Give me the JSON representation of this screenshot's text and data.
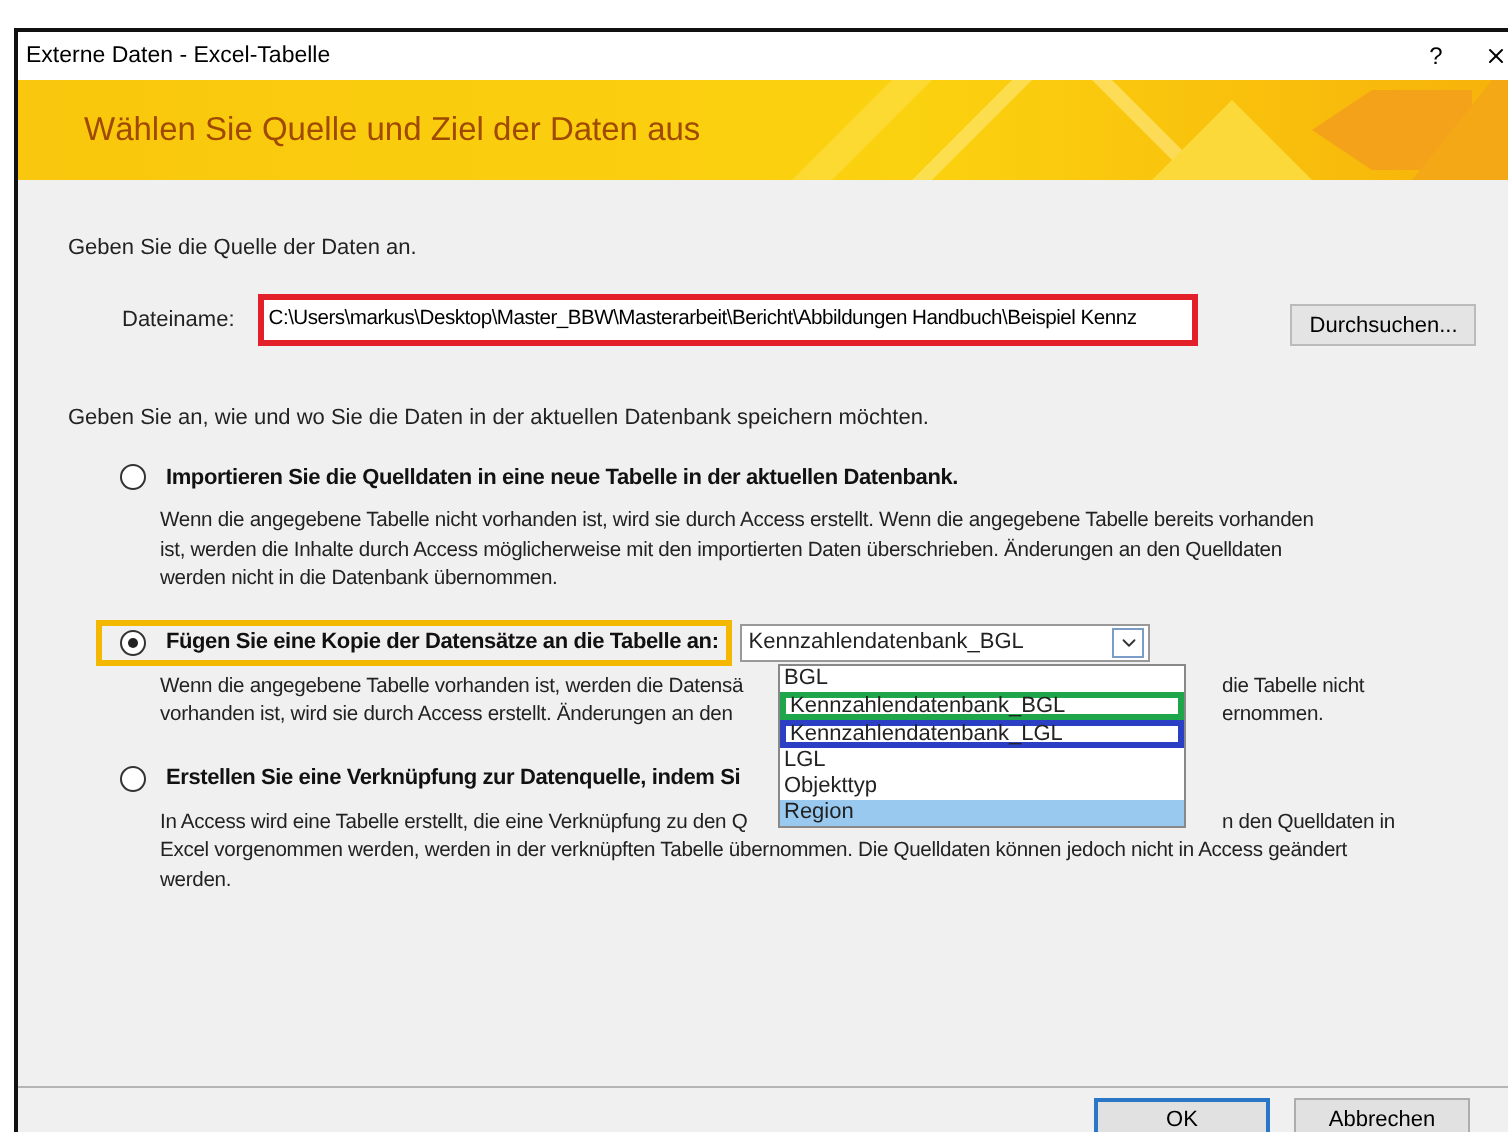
{
  "window": {
    "title": "Externe Daten - Excel-Tabelle",
    "help": "?"
  },
  "banner": {
    "title": "Wählen Sie Quelle und Ziel der Daten aus"
  },
  "source": {
    "prompt": "Geben Sie die Quelle der Daten an.",
    "label": "Dateiname:",
    "value": "C:\\Users\\markus\\Desktop\\Master_BBW\\Masterarbeit\\Bericht\\Abbildungen Handbuch\\Beispiel Kennz",
    "color": "#e3202a",
    "browse": "Durchsuchen..."
  },
  "target_prompt": "Geben Sie an, wie und wo Sie die Daten in der aktuellen Datenbank speichern möchten.",
  "options": [
    {
      "title": "Importieren Sie die Quelldaten in eine neue Tabelle in der aktuellen Datenbank.",
      "selected": false,
      "lines": [
        [
          "Wenn die angegebene Tabelle nicht vorhanden ist, wird sie durch Access erstellt. Wenn die angegebene Tabelle bereits vorhanden"
        ],
        [
          "ist, werden die Inhalte durch Access möglicherweise mit den importierten Daten überschrieben. Änderungen an den Quelldaten"
        ],
        [
          "werden nicht in die Datenbank übernommen."
        ]
      ]
    },
    {
      "title": "Fügen Sie eine Kopie der Datensätze an die Tabelle an:",
      "selected": true,
      "color": "#f5b800",
      "combo": "Kennzahlendatenbank_BGL",
      "lines": [
        [
          "Wenn die angegebene Tabelle vorhanden ist, werden die Datensä",
          "die Tabelle nicht"
        ],
        [
          "vorhanden ist, wird sie durch Access erstellt. Änderungen an den",
          "ernommen."
        ]
      ]
    },
    {
      "title": "Erstellen Sie eine Verknüpfung zur Datenquelle, indem Si",
      "selected": false,
      "lines": [
        [
          "In Access wird eine Tabelle erstellt, die eine Verknüpfung zu den Q",
          "n den Quelldaten in"
        ],
        [
          "Excel vorgenommen werden, werden in der verknüpften Tabelle übernommen. Die Quelldaten können jedoch nicht in Access geändert"
        ],
        [
          "werden."
        ]
      ]
    }
  ],
  "dropdown": [
    {
      "label": "BGL",
      "selected": false
    },
    {
      "label": "Kennzahlendatenbank_BGL",
      "selected": false,
      "color": "#1fa54a"
    },
    {
      "label": "Kennzahlendatenbank_LGL",
      "selected": false,
      "color": "#2b3fc4"
    },
    {
      "label": "LGL",
      "selected": false
    },
    {
      "label": "Objekttyp",
      "selected": false
    },
    {
      "label": "Region",
      "selected": true
    }
  ],
  "buttons": [
    "OK",
    "Abbrechen"
  ]
}
